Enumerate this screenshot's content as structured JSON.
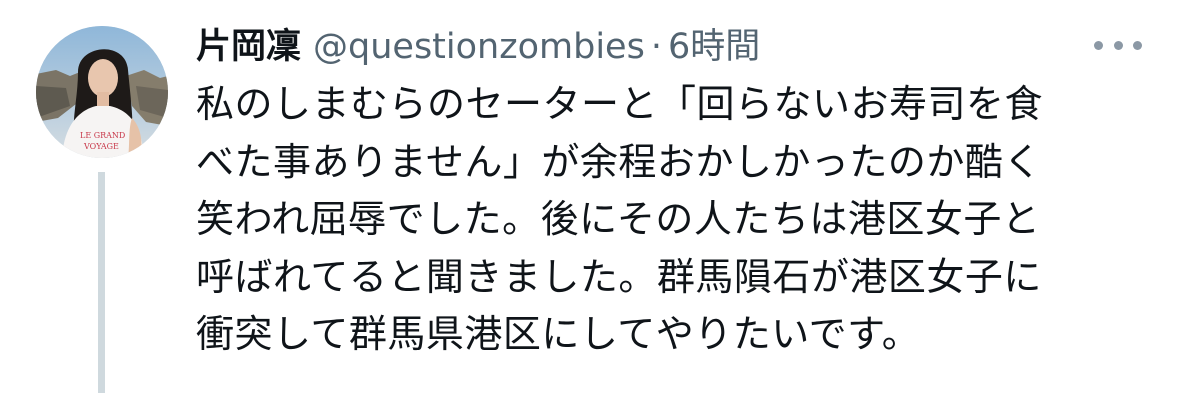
{
  "tweet": {
    "author": {
      "display_name": "片岡凜",
      "handle": "@questionzombies",
      "separator": "·",
      "timestamp": "6時間"
    },
    "body_lines": [
      "私のしまむらのセーターと「回らないお寿司を食",
      "べた事ありません」が余程おかしかったのか酷く",
      "笑われ屈辱でした。後にその人たちは港区女子と",
      "呼ばれてると聞きました。群馬隕石が港区女子に",
      "衝突して群馬県港区にしてやりたいです。"
    ],
    "avatar_shirt_text": [
      "LE GRAND",
      "VOYAGE"
    ],
    "more_icon": "more-horizontal-icon"
  },
  "colors": {
    "text_primary": "#0f1419",
    "text_secondary": "#536471",
    "thread_line": "#cfd9de",
    "background": "#ffffff"
  }
}
